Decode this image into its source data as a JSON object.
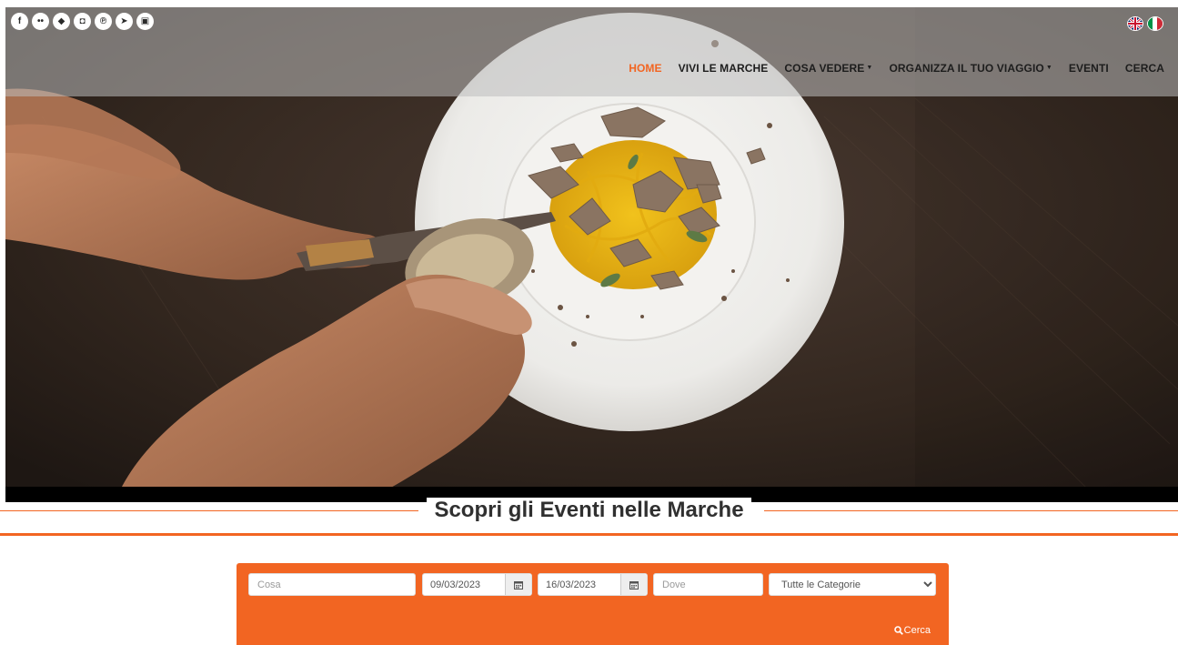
{
  "header": {
    "social_icons": [
      {
        "name": "facebook-icon",
        "glyph": "f"
      },
      {
        "name": "flickr-icon",
        "glyph": "••"
      },
      {
        "name": "foursquare-icon",
        "glyph": "◆"
      },
      {
        "name": "instagram-icon",
        "glyph": "◘"
      },
      {
        "name": "pinterest-icon",
        "glyph": "℗"
      },
      {
        "name": "twitter-icon",
        "glyph": "➤"
      },
      {
        "name": "youtube-icon",
        "glyph": "▣"
      }
    ],
    "languages": [
      {
        "name": "english-flag-icon",
        "colors": [
          "#012169",
          "#ffffff",
          "#c8102e"
        ]
      },
      {
        "name": "italian-flag-icon",
        "colors": [
          "#009246",
          "#ffffff",
          "#ce2b37"
        ]
      }
    ],
    "nav": [
      {
        "label": "HOME",
        "active": true,
        "dropdown": false
      },
      {
        "label": "VIVI LE MARCHE",
        "active": false,
        "dropdown": false
      },
      {
        "label": "COSA VEDERE",
        "active": false,
        "dropdown": true
      },
      {
        "label": "ORGANIZZA IL TUO VIAGGIO",
        "active": false,
        "dropdown": true
      },
      {
        "label": "EVENTI",
        "active": false,
        "dropdown": false
      },
      {
        "label": "CERCA",
        "active": false,
        "dropdown": false
      }
    ]
  },
  "section": {
    "title": "Scopri gli Eventi nelle Marche"
  },
  "search": {
    "what_placeholder": "Cosa",
    "date_from": "09/03/2023",
    "date_to": "16/03/2023",
    "where_placeholder": "Dove",
    "category_selected": "Tutte le Categorie",
    "button_label": "Cerca"
  },
  "colors": {
    "accent": "#f26522",
    "nav_text": "#1d1d1d",
    "title_text": "#303030"
  }
}
